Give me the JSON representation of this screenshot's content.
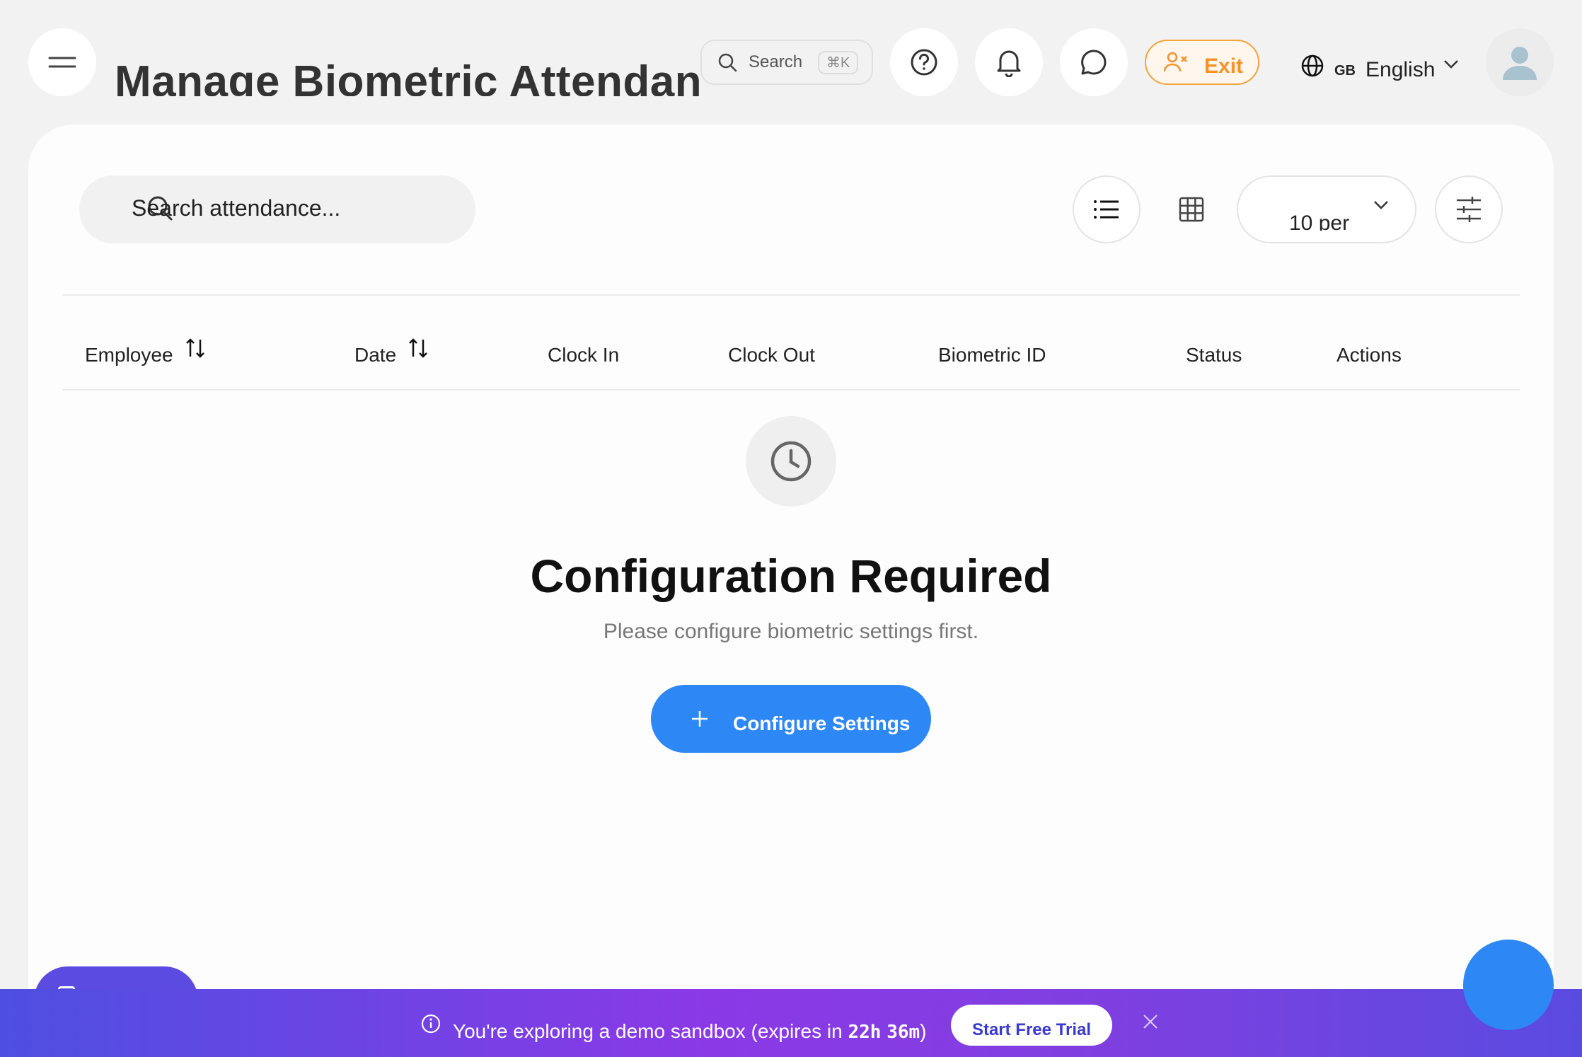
{
  "header": {
    "title": "Manage Biometric Attendance",
    "search_label": "Search",
    "search_shortcut": "⌘K",
    "exit_label": "Exit",
    "language_code": "GB",
    "language_name": "English"
  },
  "toolbar": {
    "search_placeholder": "Search attendance...",
    "per_page_label": "10 per"
  },
  "table": {
    "columns": [
      "Employee",
      "Date",
      "Clock In",
      "Clock Out",
      "Biometric ID",
      "Status",
      "Actions"
    ]
  },
  "empty_state": {
    "title": "Configuration Required",
    "subtitle": "Please configure biometric settings first.",
    "button_label": "Configure Settings"
  },
  "banner": {
    "message": "You're exploring a demo sandbox (expires in ",
    "hours": "22h",
    "minutes": "36m",
    "message_end": ")",
    "trial_label": "Start Free Trial"
  },
  "colors": {
    "accent": "#2d87f5",
    "exit": "#f5922a",
    "banner_start": "#4e4fe2",
    "banner_mid": "#8b39e6"
  }
}
